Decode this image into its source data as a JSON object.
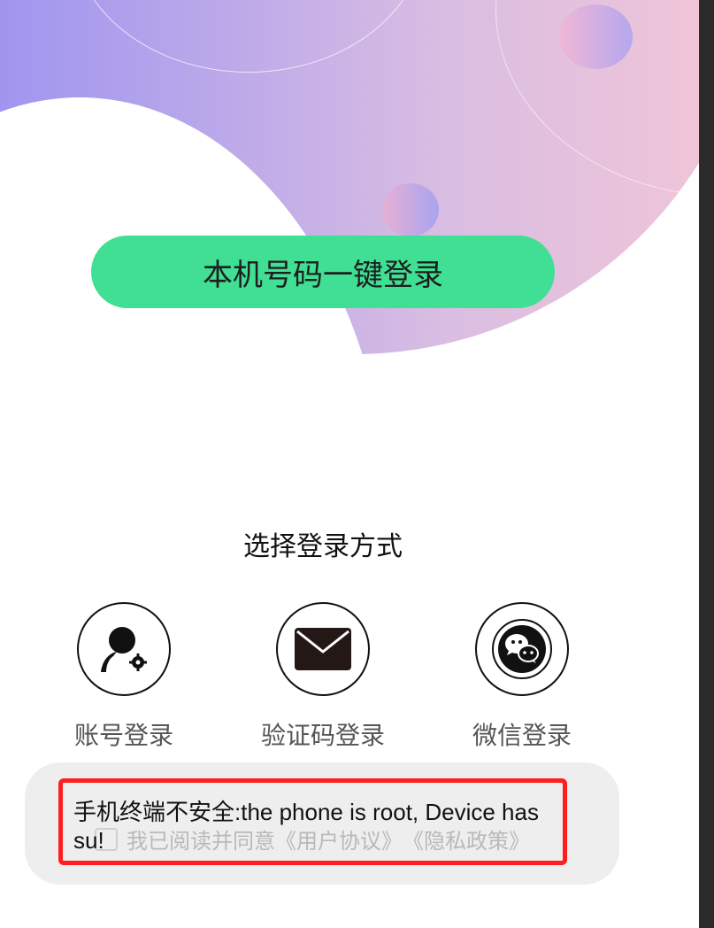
{
  "login": {
    "one_key_button": "本机号码一键登录",
    "choose_title": "选择登录方式",
    "methods": [
      {
        "label": "账号登录",
        "icon": "account-icon"
      },
      {
        "label": "验证码登录",
        "icon": "envelope-icon"
      },
      {
        "label": "微信登录",
        "icon": "wechat-icon"
      }
    ],
    "agreement": {
      "prefix": "我已阅读并同意",
      "user_agreement": "《用户协议》",
      "privacy_policy": "《隐私政策》",
      "checked": false
    }
  },
  "toast": {
    "message": "手机终端不安全:the phone is root, Device has su!"
  },
  "colors": {
    "primary_button": "#40df94",
    "toast_border": "#ff1e1e",
    "gradient_start": "#9b93f0",
    "gradient_end": "#f4c7d6"
  }
}
